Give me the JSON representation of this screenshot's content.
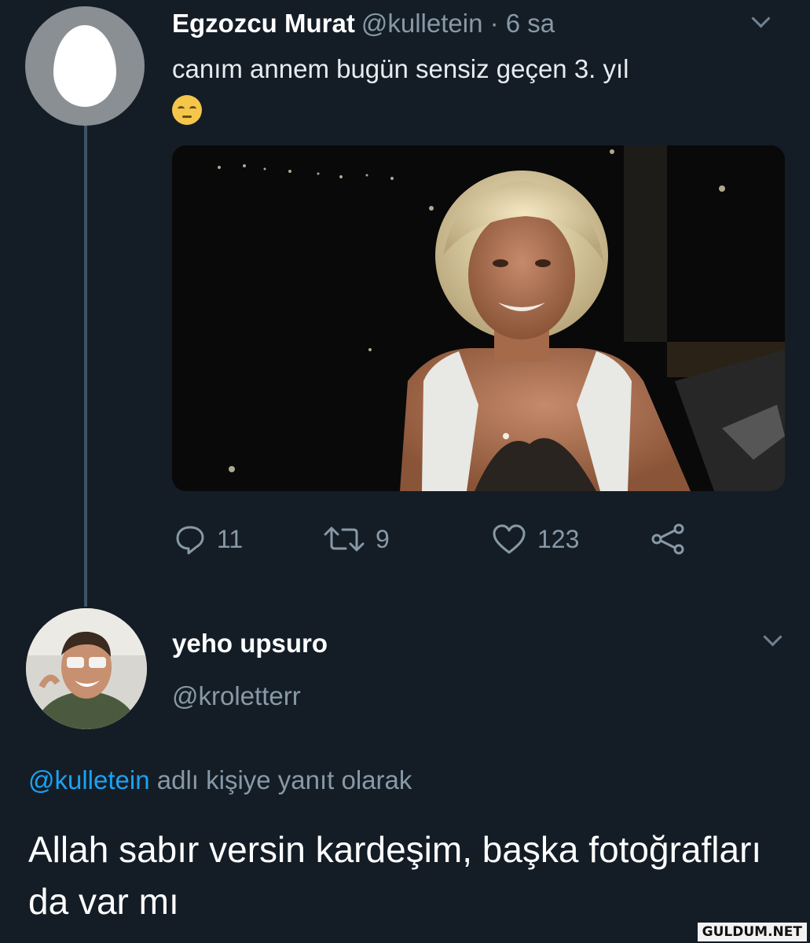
{
  "tweet": {
    "author_name": "Egzozcu Murat",
    "meta": "@kulletein · 6 sa",
    "text": "canım annem bugün sensiz geçen 3. yıl",
    "emoji": "pensive-face-emoji",
    "actions": {
      "replies": "11",
      "retweets": "9",
      "likes": "123"
    }
  },
  "reply": {
    "author_name": "yeho upsuro",
    "handle": "@kroletterr",
    "context_mention": "@kulletein",
    "context_text": " adlı kişiye yanıt olarak",
    "text": "Allah sabır versin kardeşim, başka fotoğrafları da var mı"
  },
  "watermark": "GULDUM.NET",
  "colors": {
    "background": "#141d26",
    "muted": "#8899a6",
    "link": "#1da1f2",
    "thread_line": "#3d5466"
  },
  "icons": [
    "egg-avatar",
    "chevron-down-icon",
    "reply-icon",
    "retweet-icon",
    "like-icon",
    "share-icon"
  ]
}
